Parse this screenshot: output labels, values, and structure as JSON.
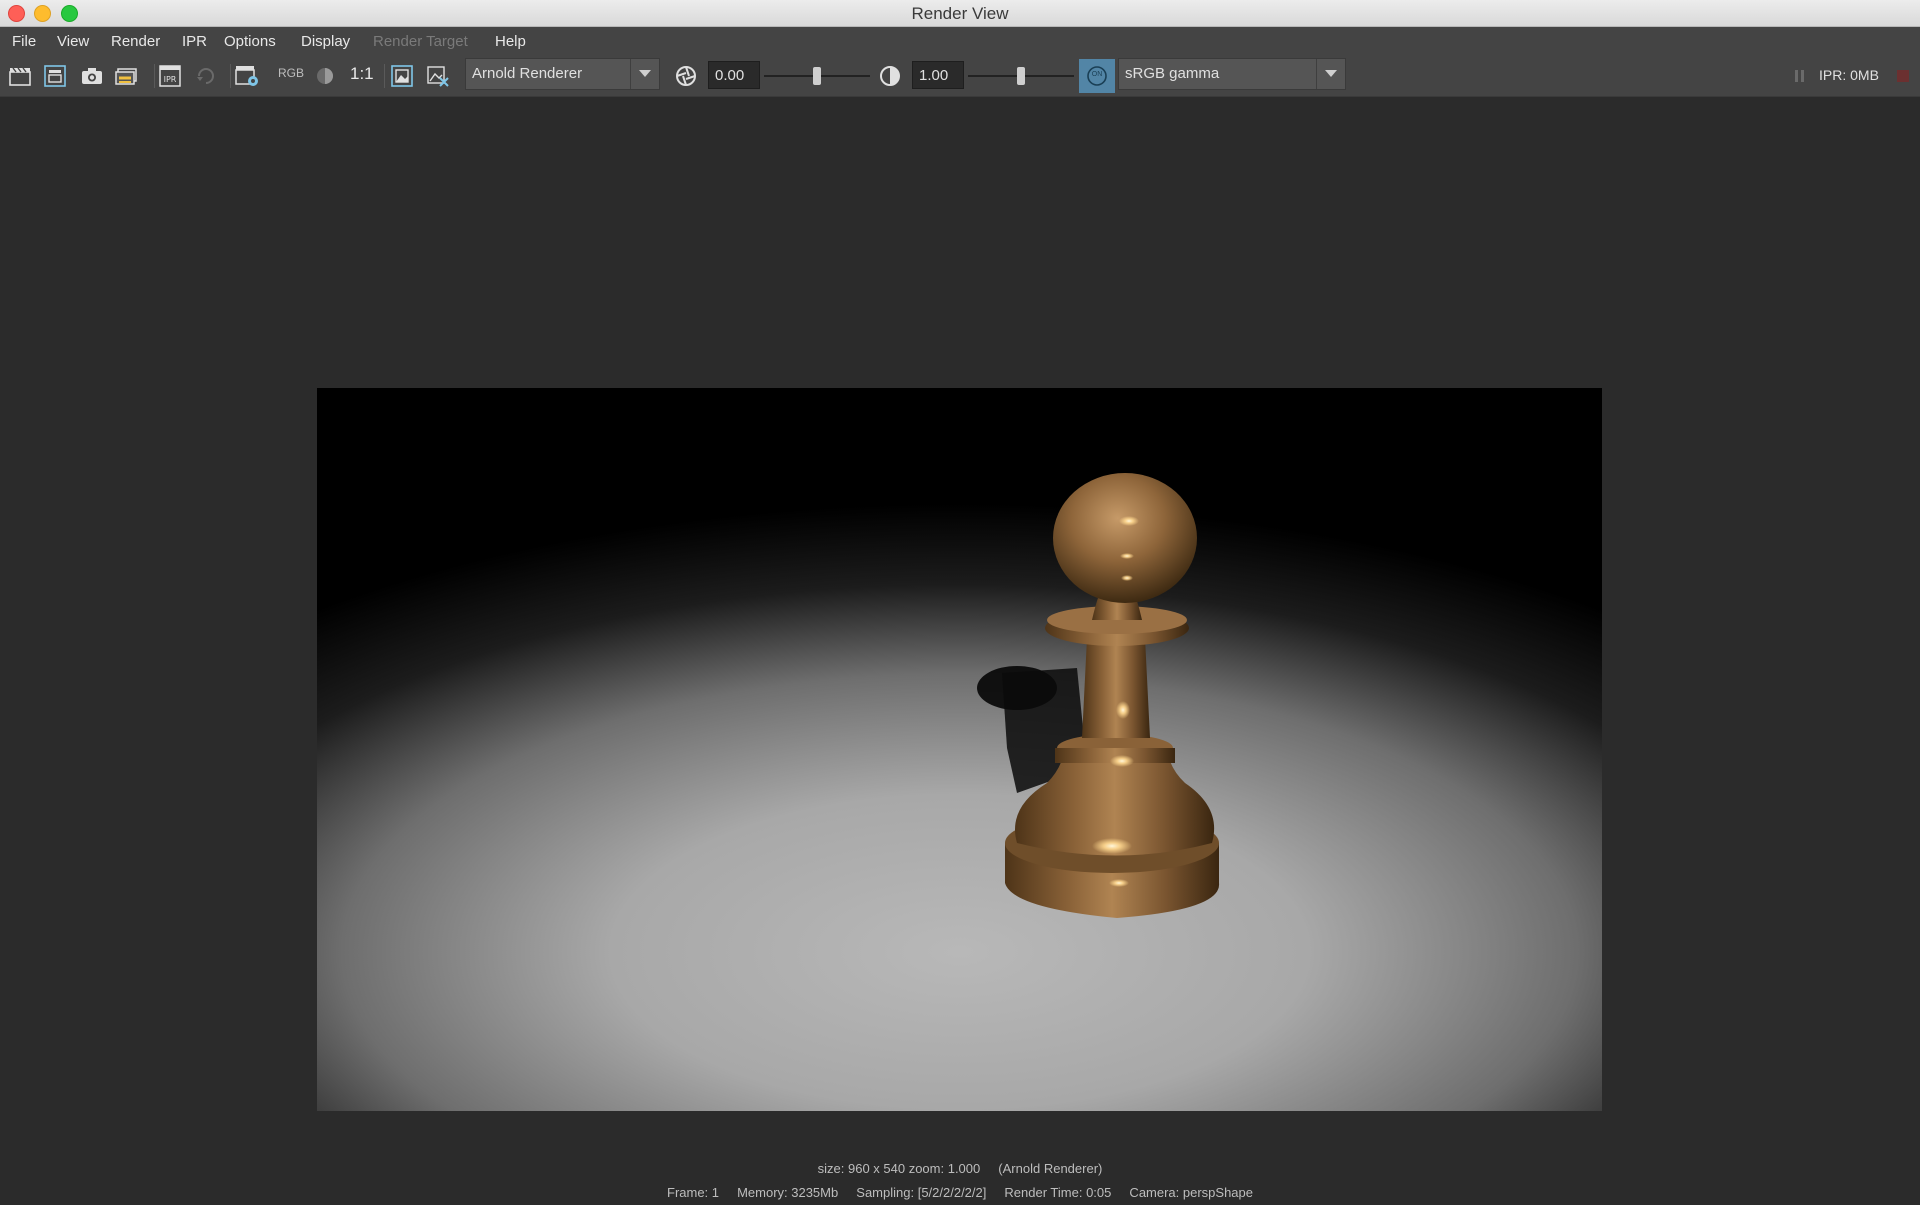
{
  "window": {
    "title": "Render View"
  },
  "menu": {
    "items": [
      {
        "label": "File",
        "disabled": false
      },
      {
        "label": "View",
        "disabled": false
      },
      {
        "label": "Render",
        "disabled": false
      },
      {
        "label": "IPR",
        "disabled": false
      },
      {
        "label": "Options",
        "disabled": false
      },
      {
        "label": "Display",
        "disabled": false
      },
      {
        "label": "Render Target",
        "disabled": true
      },
      {
        "label": "Help",
        "disabled": false
      }
    ]
  },
  "toolbar": {
    "rgb_label": "RGB",
    "ratio_label": "1:1",
    "renderer": "Arnold Renderer",
    "exposure_value": "0.00",
    "gamma_value": "1.00",
    "exposure_level": 0.5,
    "gamma_level": 0.5,
    "on_label": "ON",
    "colorspace": "sRGB gamma",
    "ipr_memory": "IPR: 0MB"
  },
  "status": {
    "line1": "size: 960 x 540 zoom: 1.000     (Arnold Renderer)",
    "line2": "Frame: 1     Memory: 3235Mb     Sampling: [5/2/2/2/2/2]     Render Time: 0:05     Camera: perspShape"
  },
  "colors": {
    "accent_on": "#5285a6",
    "background": "#2b2b2b",
    "toolbar": "#444444"
  }
}
